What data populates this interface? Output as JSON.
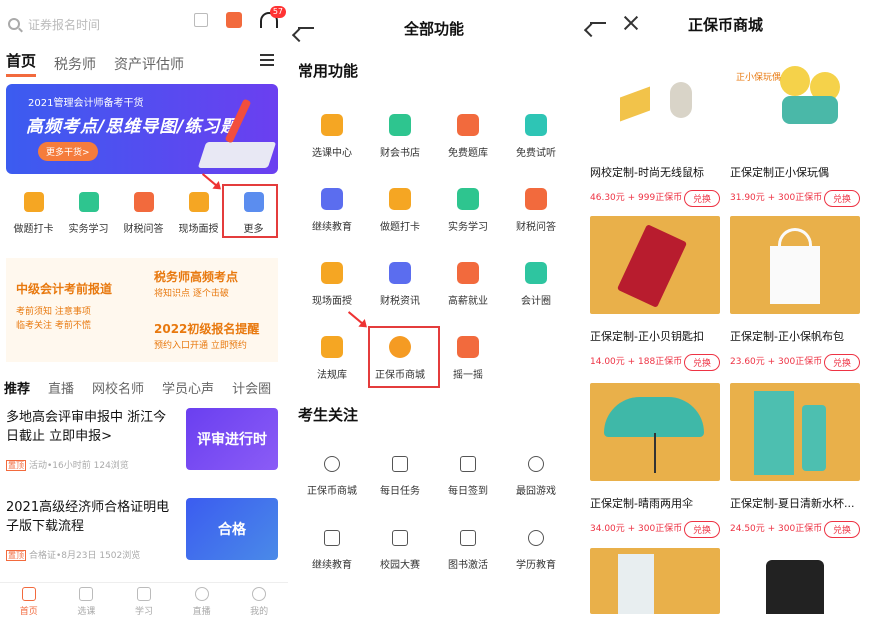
{
  "home": {
    "search_placeholder": "证券报名时间",
    "badge_count": "57",
    "tabs": [
      "首页",
      "税务师",
      "资产评估师"
    ],
    "banner": {
      "line1": "2021管理会计师备考干货",
      "line2": "高频考点/思维导图/练习题",
      "cta": "更多干货>"
    },
    "quick_icons": [
      {
        "label": "做题打卡",
        "color": "#f5a623"
      },
      {
        "label": "实务学习",
        "color": "#2ec58f"
      },
      {
        "label": "财税问答",
        "color": "#f26a3d"
      },
      {
        "label": "现场面授",
        "color": "#f5a623"
      },
      {
        "label": "更多",
        "color": "#5b8def"
      }
    ],
    "promo": {
      "a_title": "中级会计考前报道",
      "a_sub1": "考前须知 注意事项",
      "a_sub2": "临考关注 考前不慌",
      "b_title": "税务师高频考点",
      "b_sub": "将知识点 逐个击破",
      "c_title": "2022初级报名提醒",
      "c_sub": "预约入口开通 立即预约"
    },
    "feed_tabs": [
      "推荐",
      "直播",
      "网校名师",
      "学员心声",
      "计会圈"
    ],
    "news": [
      {
        "title": "多地高会评审申报中 浙江今日截止 立即申报>",
        "tag": "置顶",
        "meta": "活动•16小时前   124浏览",
        "thumb": "评审进行时"
      },
      {
        "title": "2021高级经济师合格证明电子版下载流程",
        "tag": "置顶",
        "meta": "合格证•8月23日   1502浏览",
        "thumb": "合格"
      }
    ],
    "bottom_nav": [
      "首页",
      "选课",
      "学习",
      "直播",
      "我的"
    ]
  },
  "features": {
    "title": "全部功能",
    "section1": "常用功能",
    "common": [
      {
        "label": "选课中心",
        "color": "#f5a623"
      },
      {
        "label": "财会书店",
        "color": "#2ec58f"
      },
      {
        "label": "免费题库",
        "color": "#f26a3d"
      },
      {
        "label": "免费试听",
        "color": "#2ec5b5"
      },
      {
        "label": "继续教育",
        "color": "#5b6def"
      },
      {
        "label": "做题打卡",
        "color": "#f5a623"
      },
      {
        "label": "实务学习",
        "color": "#2ec58f"
      },
      {
        "label": "财税问答",
        "color": "#f26a3d"
      },
      {
        "label": "现场面授",
        "color": "#f5a623"
      },
      {
        "label": "财税资讯",
        "color": "#5b6def"
      },
      {
        "label": "高薪就业",
        "color": "#f26a3d"
      },
      {
        "label": "会计圈",
        "color": "#2ec5a0"
      },
      {
        "label": "法规库",
        "color": "#f5a623"
      },
      {
        "label": "正保币商城",
        "color": "#f59b23"
      },
      {
        "label": "摇一摇",
        "color": "#f26a3d"
      }
    ],
    "section2": "考生关注",
    "attention": [
      "正保币商城",
      "每日任务",
      "每日签到",
      "最囧游戏",
      "继续教育",
      "校园大赛",
      "图书激活",
      "学历教育"
    ]
  },
  "mall": {
    "title": "正保币商城",
    "products": [
      {
        "name": "网校定制-时尚无线鼠标",
        "price": "46.30元 + 999正保币",
        "action": "兑换",
        "bg": "#ffffff",
        "label": ""
      },
      {
        "name": "正保定制正小保玩偶",
        "price": "31.90元 + 300正保币",
        "action": "兑换",
        "bg": "#ffffff",
        "label": "正小保玩偶"
      },
      {
        "name": "正保定制-正小贝钥匙扣",
        "price": "14.00元 + 188正保币",
        "action": "兑换",
        "bg": "#e9b04a",
        "label": ""
      },
      {
        "name": "正保定制-正小保帆布包",
        "price": "23.60元 + 300正保币",
        "action": "兑换",
        "bg": "#e9b04a",
        "label": ""
      },
      {
        "name": "正保定制-晴雨两用伞",
        "price": "34.00元 + 300正保币",
        "action": "兑换",
        "bg": "#e9b04a",
        "label": ""
      },
      {
        "name": "正保定制-夏日清新水杯...",
        "price": "24.50元 + 300正保币",
        "action": "兑换",
        "bg": "#e9b04a",
        "label": ""
      },
      {
        "name": "",
        "price": "",
        "action": "",
        "bg": "#e9b04a",
        "label": ""
      },
      {
        "name": "",
        "price": "",
        "action": "",
        "bg": "#ffffff",
        "label": ""
      }
    ]
  }
}
